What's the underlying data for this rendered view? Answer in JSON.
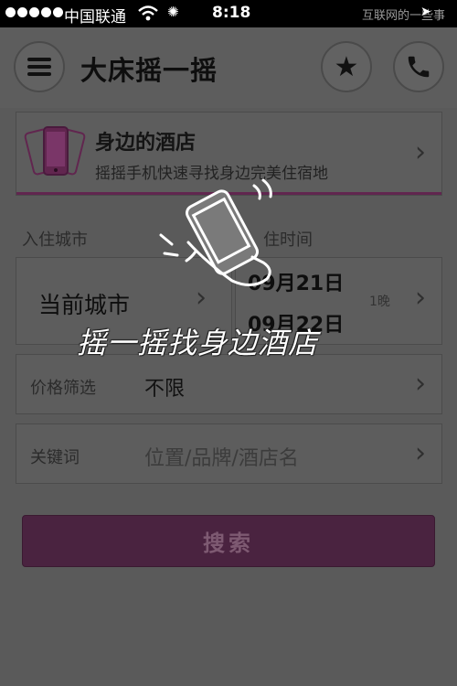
{
  "status_bar": {
    "carrier": "中国联通",
    "time": "8:18",
    "watermark": "互联网的一些事"
  },
  "header": {
    "title": "大床摇一摇"
  },
  "nearby": {
    "title": "身边的酒店",
    "subtitle": "摇摇手机快速寻找身边完美住宿地"
  },
  "labels": {
    "checkin_city": "入住城市",
    "checkin_time": "住时间"
  },
  "city": {
    "value": "当前城市"
  },
  "dates": {
    "checkin": "09月21日",
    "checkout": "09月22日",
    "nights": "1晚"
  },
  "price": {
    "label": "价格筛选",
    "value": "不限"
  },
  "keyword": {
    "label": "关键词",
    "placeholder": "位置/品牌/酒店名"
  },
  "search_button": "搜索",
  "overlay": {
    "text": "摇一摇找身边酒店"
  },
  "colors": {
    "accent": "#61264f",
    "button": "#4a2340",
    "dim_background": "#5a5a5a"
  },
  "icons": {
    "menu": "hamburger-icon",
    "favorite": "star-icon",
    "call": "phone-icon",
    "chevron": "chevron-right-icon",
    "nearby": "shaking-phone-icon",
    "shake": "hand-shaking-phone-icon"
  }
}
